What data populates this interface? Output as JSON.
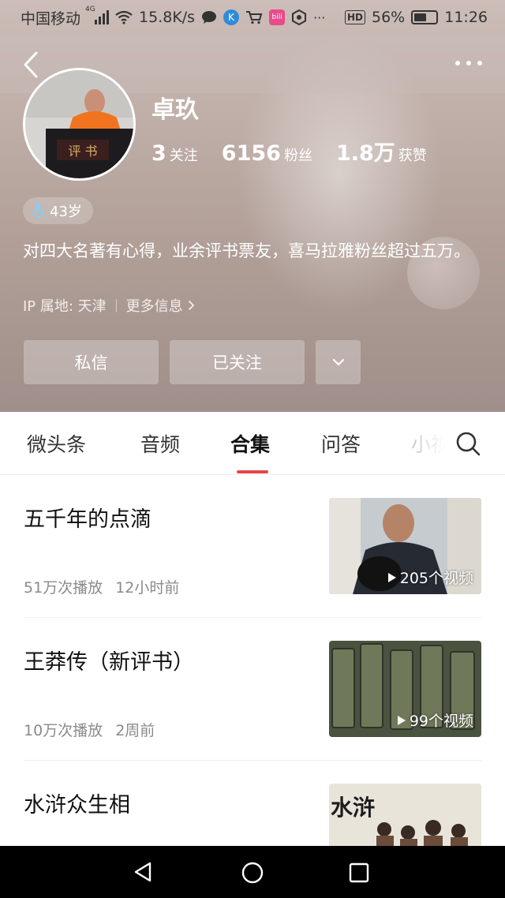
{
  "status_bar": {
    "carrier": "中国移动",
    "network_sup": "4G",
    "speed": "15.8K/s",
    "battery": "56%",
    "battery_fraction": 0.56,
    "time": "11:26",
    "hd_label": "HD",
    "more": "···"
  },
  "profile": {
    "name": "卓玖",
    "stats": [
      {
        "num": "3",
        "label": "关注"
      },
      {
        "num": "6156",
        "label": "粉丝"
      },
      {
        "num": "1.8万",
        "label": "获赞"
      }
    ],
    "age": "43岁",
    "bio": "对四大名著有心得，业余评书票友，喜马拉雅粉丝超过五万。",
    "ip_location": "IP 属地: 天津",
    "more_info": "更多信息",
    "avatar_sign": "评 书"
  },
  "actions": {
    "message": "私信",
    "followed": "已关注"
  },
  "tabs": [
    {
      "label": "微头条"
    },
    {
      "label": "音频"
    },
    {
      "label": "合集"
    },
    {
      "label": "问答"
    },
    {
      "label": "小视"
    }
  ],
  "collections": [
    {
      "title": "五千年的点滴",
      "plays": "51万次播放",
      "time": "12小时前",
      "count": "205个视频"
    },
    {
      "title": "王莽传（新评书）",
      "plays": "10万次播放",
      "time": "2周前",
      "count": "99个视频"
    },
    {
      "title": "水浒众生相",
      "thumb_text": "水浒"
    }
  ],
  "colors": {
    "accent": "#e64545"
  }
}
